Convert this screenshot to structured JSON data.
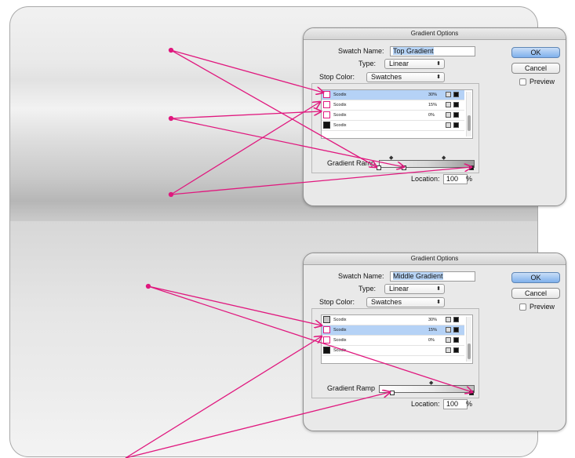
{
  "dialogs": [
    {
      "title": "Gradient Options",
      "swatch_name_label": "Swatch Name:",
      "swatch_name": "Top Gradient",
      "type_label": "Type:",
      "type_value": "Linear",
      "stop_color_label": "Stop Color:",
      "stop_color_value": "Swatches",
      "swatches": [
        {
          "name": "Scodix",
          "tint": "30%",
          "icon": "gradient-swatch-icon",
          "selected": true
        },
        {
          "name": "Scodix",
          "tint": "15%",
          "icon": "gradient-swatch-icon",
          "selected": false
        },
        {
          "name": "Scodix",
          "tint": "0%",
          "icon": "gradient-swatch-icon",
          "selected": false
        },
        {
          "name": "Scodix",
          "tint": "",
          "icon": "solid-swatch-icon",
          "selected": false
        }
      ],
      "gradient_ramp_label": "Gradient Ramp",
      "location_label": "Location:",
      "location_value": "100",
      "location_unit": "%",
      "ok_label": "OK",
      "cancel_label": "Cancel",
      "preview_label": "Preview"
    },
    {
      "title": "Gradient Options",
      "swatch_name_label": "Swatch Name:",
      "swatch_name": "Middle Gradient",
      "type_label": "Type:",
      "type_value": "Linear",
      "stop_color_label": "Stop Color:",
      "stop_color_value": "Swatches",
      "swatches": [
        {
          "name": "Scodix",
          "tint": "30%",
          "icon": "gray-swatch-icon",
          "selected": false
        },
        {
          "name": "Scodix",
          "tint": "15%",
          "icon": "gradient-swatch-icon",
          "selected": true
        },
        {
          "name": "Scodix",
          "tint": "0%",
          "icon": "gradient-swatch-icon",
          "selected": false
        },
        {
          "name": "Scodix",
          "tint": "",
          "icon": "solid-swatch-icon",
          "selected": false
        }
      ],
      "gradient_ramp_label": "Gradient Ramp",
      "location_label": "Location:",
      "location_value": "100",
      "location_unit": "%",
      "ok_label": "OK",
      "cancel_label": "Cancel",
      "preview_label": "Preview"
    }
  ],
  "colors": {
    "annotation": "#e0187e",
    "selection": "#b5d2f6",
    "default_button": "#7fb0ec"
  }
}
